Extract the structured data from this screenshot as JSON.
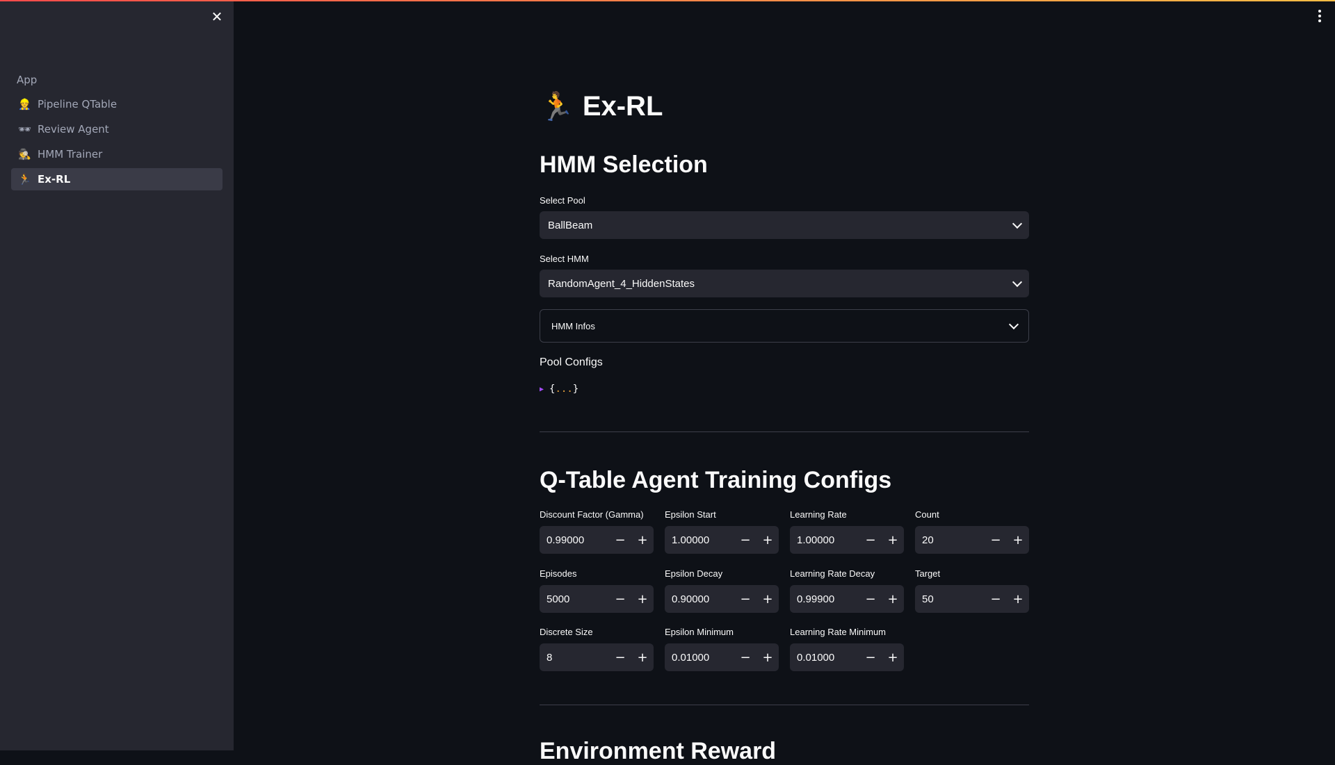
{
  "sidebar": {
    "section_title": "App",
    "items": [
      {
        "icon": "👷",
        "label": "Pipeline QTable"
      },
      {
        "icon": "🕶",
        "label": "Review Agent"
      },
      {
        "icon": "🕵",
        "label": "HMM Trainer"
      },
      {
        "icon": "🏃",
        "label": "Ex-RL"
      }
    ]
  },
  "header": {
    "title_icon": "🏃",
    "title": "Ex-RL"
  },
  "hmm": {
    "heading": "HMM Selection",
    "pool_label": "Select Pool",
    "pool_value": "BallBeam",
    "hmm_label": "Select HMM",
    "hmm_value": "RandomAgent_4_HiddenStates",
    "infos_label": "HMM Infos",
    "pool_configs_label": "Pool Configs",
    "json_open": "{",
    "json_dots": "...",
    "json_close": "}"
  },
  "training": {
    "heading": "Q-Table Agent Training Configs",
    "fields": [
      {
        "label": "Discount Factor (Gamma)",
        "value": "0.99000"
      },
      {
        "label": "Epsilon Start",
        "value": "1.00000"
      },
      {
        "label": "Learning Rate",
        "value": "1.00000"
      },
      {
        "label": "Count",
        "value": "20"
      },
      {
        "label": "Episodes",
        "value": "5000"
      },
      {
        "label": "Epsilon Decay",
        "value": "0.90000"
      },
      {
        "label": "Learning Rate Decay",
        "value": "0.99900"
      },
      {
        "label": "Target",
        "value": "50"
      },
      {
        "label": "Discrete Size",
        "value": "8"
      },
      {
        "label": "Epsilon Minimum",
        "value": "0.01000"
      },
      {
        "label": "Learning Rate Minimum",
        "value": "0.01000"
      }
    ],
    "minus": "−",
    "plus": "+"
  },
  "next_section": {
    "heading": "Environment Reward"
  },
  "colors": {
    "accent_start": "#ff4b4b",
    "accent_end": "#ffbd45",
    "background": "#0e1117",
    "sidebar": "#262730"
  }
}
